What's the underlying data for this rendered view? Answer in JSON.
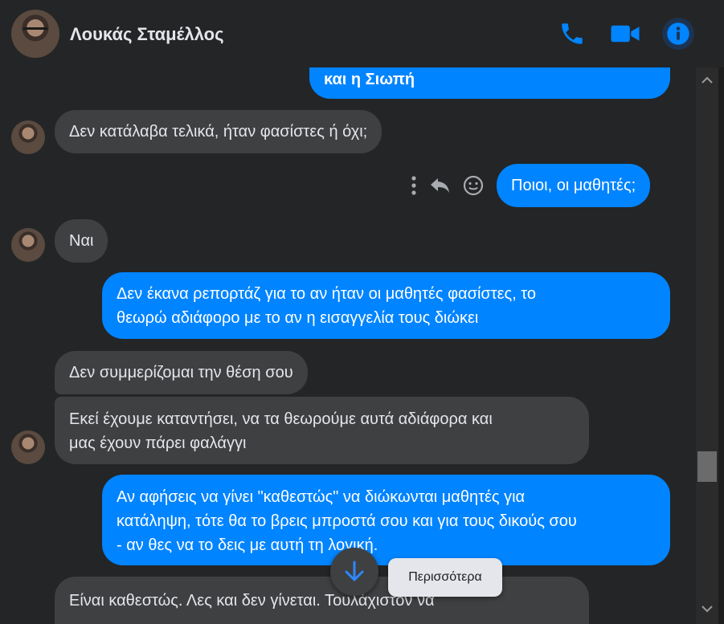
{
  "header": {
    "contact_name": "Λουκάς Σταμέλλος",
    "accent": "#0084ff"
  },
  "messages": [
    {
      "from": "me",
      "text": "και η Σιωπή"
    },
    {
      "from": "them",
      "text": "Δεν κατάλαβα τελικά, ήταν φασίστες ή όχι;"
    },
    {
      "from": "me",
      "text": "Ποιοι, οι μαθητές;"
    },
    {
      "from": "them",
      "text": "Ναι"
    },
    {
      "from": "me",
      "lines": [
        "Δεν έκανα ρεπορτάζ για το αν ήταν οι μαθητές φασίστες, το",
        "θεωρώ αδιάφορο με το αν η εισαγγελία τους διώκει"
      ]
    },
    {
      "from": "them",
      "text": "Δεν συμμερίζομαι την θέση σου"
    },
    {
      "from": "them",
      "lines": [
        "Εκεί έχουμε καταντήσει, να τα θεωρούμε αυτά αδιάφορα και",
        "μας έχουν πάρει φαλάγγι"
      ]
    },
    {
      "from": "me",
      "lines": [
        "Αν αφήσεις να γίνει \"καθεστώς\" να διώκωνται μαθητές για",
        "κατάληψη, τότε θα το βρεις μπροστά σου και για τους δικούς σου",
        "- αν θες να το δεις με αυτή τη λογική."
      ]
    },
    {
      "from": "them",
      "lines": [
        "Είναι καθεστώς. Λες και δεν γίνεται. Τουλάχιστον να",
        ""
      ]
    }
  ],
  "message_actions": [
    "more-icon",
    "reply-icon",
    "react-icon"
  ],
  "tooltip": {
    "text": "Περισσότερα"
  },
  "colors": {
    "incoming": "#3e4042",
    "outgoing": "#0084ff",
    "background": "#242526"
  }
}
